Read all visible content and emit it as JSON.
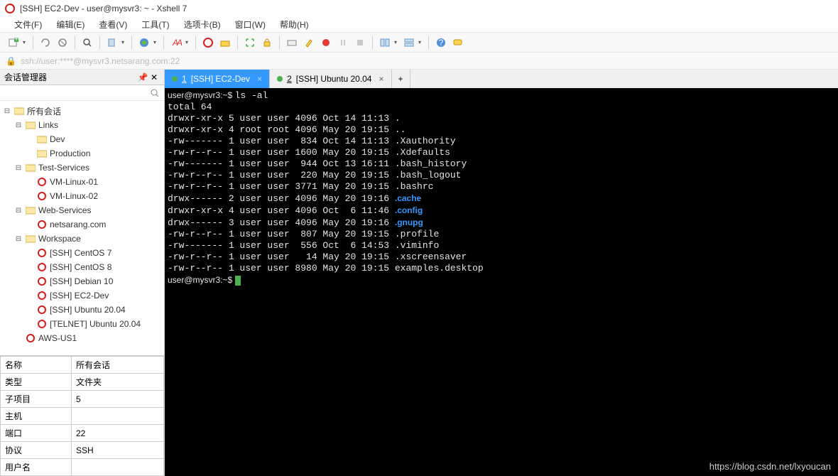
{
  "titlebar": {
    "title": "[SSH] EC2-Dev - user@mysvr3: ~ - Xshell 7"
  },
  "menu": [
    "文件(F)",
    "编辑(E)",
    "查看(V)",
    "工具(T)",
    "选项卡(B)",
    "窗口(W)",
    "帮助(H)"
  ],
  "address": "ssh://user:****@mysvr3.netsarang.com:22",
  "sidebar": {
    "title": "会话管理器",
    "root": "所有会话",
    "tree": [
      {
        "label": "Links",
        "type": "folder",
        "indent": 1,
        "toggle": "-"
      },
      {
        "label": "Dev",
        "type": "folder",
        "indent": 2,
        "toggle": ""
      },
      {
        "label": "Production",
        "type": "folder",
        "indent": 2,
        "toggle": ""
      },
      {
        "label": "Test-Services",
        "type": "folder",
        "indent": 1,
        "toggle": "-"
      },
      {
        "label": "VM-Linux-01",
        "type": "session",
        "indent": 2,
        "toggle": ""
      },
      {
        "label": "VM-Linux-02",
        "type": "session",
        "indent": 2,
        "toggle": ""
      },
      {
        "label": "Web-Services",
        "type": "folder",
        "indent": 1,
        "toggle": "-"
      },
      {
        "label": "netsarang.com",
        "type": "session",
        "indent": 2,
        "toggle": ""
      },
      {
        "label": "Workspace",
        "type": "folder",
        "indent": 1,
        "toggle": "-"
      },
      {
        "label": "[SSH] CentOS 7",
        "type": "session",
        "indent": 2,
        "toggle": ""
      },
      {
        "label": "[SSH] CentOS 8",
        "type": "session",
        "indent": 2,
        "toggle": ""
      },
      {
        "label": "[SSH] Debian 10",
        "type": "session",
        "indent": 2,
        "toggle": ""
      },
      {
        "label": "[SSH] EC2-Dev",
        "type": "session",
        "indent": 2,
        "toggle": ""
      },
      {
        "label": "[SSH] Ubuntu 20.04",
        "type": "session",
        "indent": 2,
        "toggle": ""
      },
      {
        "label": "[TELNET] Ubuntu 20.04",
        "type": "session",
        "indent": 2,
        "toggle": ""
      },
      {
        "label": "AWS-US1",
        "type": "session",
        "indent": 1,
        "toggle": ""
      }
    ],
    "props": [
      {
        "k": "名称",
        "v": "所有会话"
      },
      {
        "k": "类型",
        "v": "文件夹"
      },
      {
        "k": "子项目",
        "v": "5"
      },
      {
        "k": "主机",
        "v": ""
      },
      {
        "k": "端口",
        "v": "22"
      },
      {
        "k": "协议",
        "v": "SSH"
      },
      {
        "k": "用户名",
        "v": ""
      }
    ]
  },
  "tabs": [
    {
      "num": "1",
      "label": "[SSH] EC2-Dev",
      "active": true,
      "dot": "green"
    },
    {
      "num": "2",
      "label": "[SSH] Ubuntu 20.04",
      "active": false,
      "dot": "green"
    }
  ],
  "terminal": {
    "prompt1": "user@mysvr3:~$ ",
    "cmd1": "ls -al",
    "lines": [
      "total 64",
      "drwxr-xr-x 5 user user 4096 Oct 14 11:13 .",
      "drwxr-xr-x 4 root root 4096 May 20 19:15 ..",
      "-rw------- 1 user user  834 Oct 14 11:13 .Xauthority",
      "-rw-r--r-- 1 user user 1600 May 20 19:15 .Xdefaults",
      "-rw------- 1 user user  944 Oct 13 16:11 .bash_history",
      "-rw-r--r-- 1 user user  220 May 20 19:15 .bash_logout",
      "-rw-r--r-- 1 user user 3771 May 20 19:15 .bashrc"
    ],
    "dir_lines": [
      {
        "pre": "drwx------ 2 user user 4096 May 20 19:16 ",
        "name": ".cache"
      },
      {
        "pre": "drwxr-xr-x 4 user user 4096 Oct  6 11:46 ",
        "name": ".config"
      },
      {
        "pre": "drwx------ 3 user user 4096 May 20 19:16 ",
        "name": ".gnupg"
      }
    ],
    "lines2": [
      "-rw-r--r-- 1 user user  807 May 20 19:15 .profile",
      "-rw------- 1 user user  556 Oct  6 14:53 .viminfo",
      "-rw-r--r-- 1 user user   14 May 20 19:15 .xscreensaver",
      "-rw-r--r-- 1 user user 8980 May 20 19:15 examples.desktop"
    ],
    "prompt2": "user@mysvr3:~$ "
  },
  "watermark": "https://blog.csdn.net/lxyoucan"
}
